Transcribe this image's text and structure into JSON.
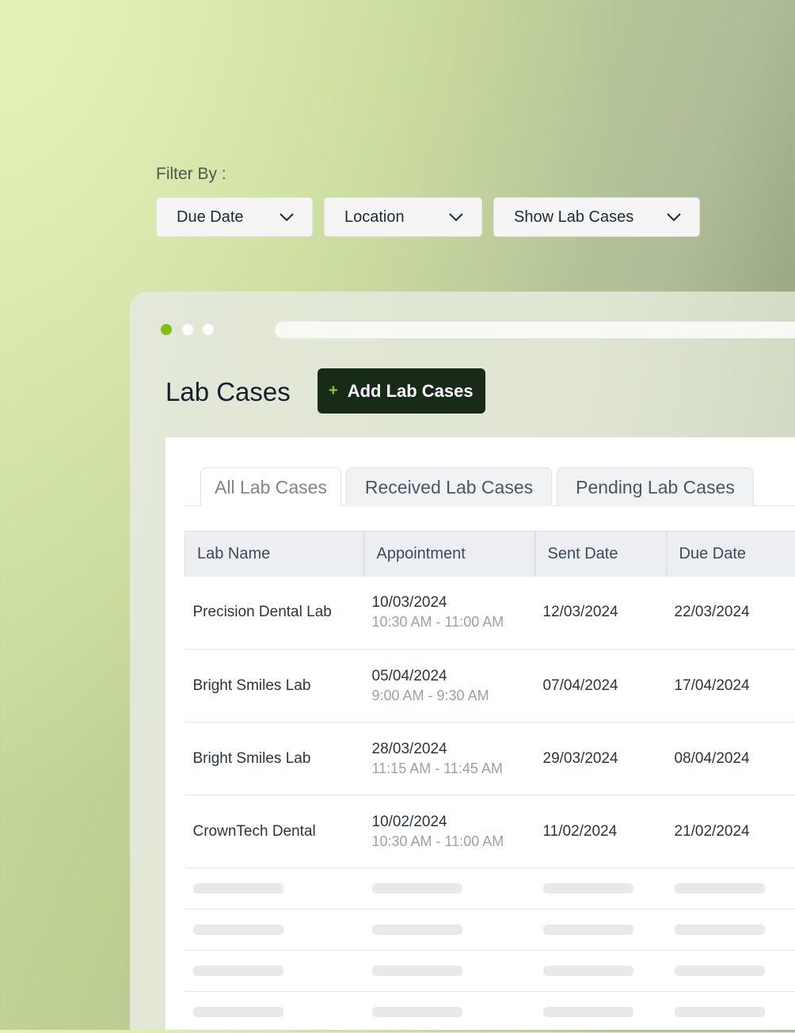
{
  "filter": {
    "label": "Filter By :",
    "dropdowns": [
      "Due Date",
      "Location",
      "Show Lab Cases"
    ]
  },
  "window": {
    "dot_colors": [
      "#84bd12",
      "#ffffff",
      "#ffffff"
    ]
  },
  "page": {
    "title": "Lab Cases",
    "add_button": "Add Lab Cases"
  },
  "tabs": [
    "All Lab Cases",
    "Received Lab Cases",
    "Pending Lab Cases"
  ],
  "table": {
    "headers": [
      "Lab Name",
      "Appointment",
      "Sent Date",
      "Due Date"
    ],
    "rows": [
      {
        "lab": "Precision Dental Lab",
        "date": "10/03/2024",
        "time": "10:30 AM - 11:00 AM",
        "sent": "12/03/2024",
        "due": "22/03/2024"
      },
      {
        "lab": "Bright Smiles Lab",
        "date": "05/04/2024",
        "time": "9:00 AM - 9:30 AM",
        "sent": "07/04/2024",
        "due": "17/04/2024"
      },
      {
        "lab": "Bright Smiles Lab",
        "date": "28/03/2024",
        "time": "11:15 AM - 11:45 AM",
        "sent": "29/03/2024",
        "due": "08/04/2024"
      },
      {
        "lab": "CrownTech Dental",
        "date": "10/02/2024",
        "time": "10:30 AM - 11:00 AM",
        "sent": "11/02/2024",
        "due": "21/02/2024"
      }
    ]
  }
}
